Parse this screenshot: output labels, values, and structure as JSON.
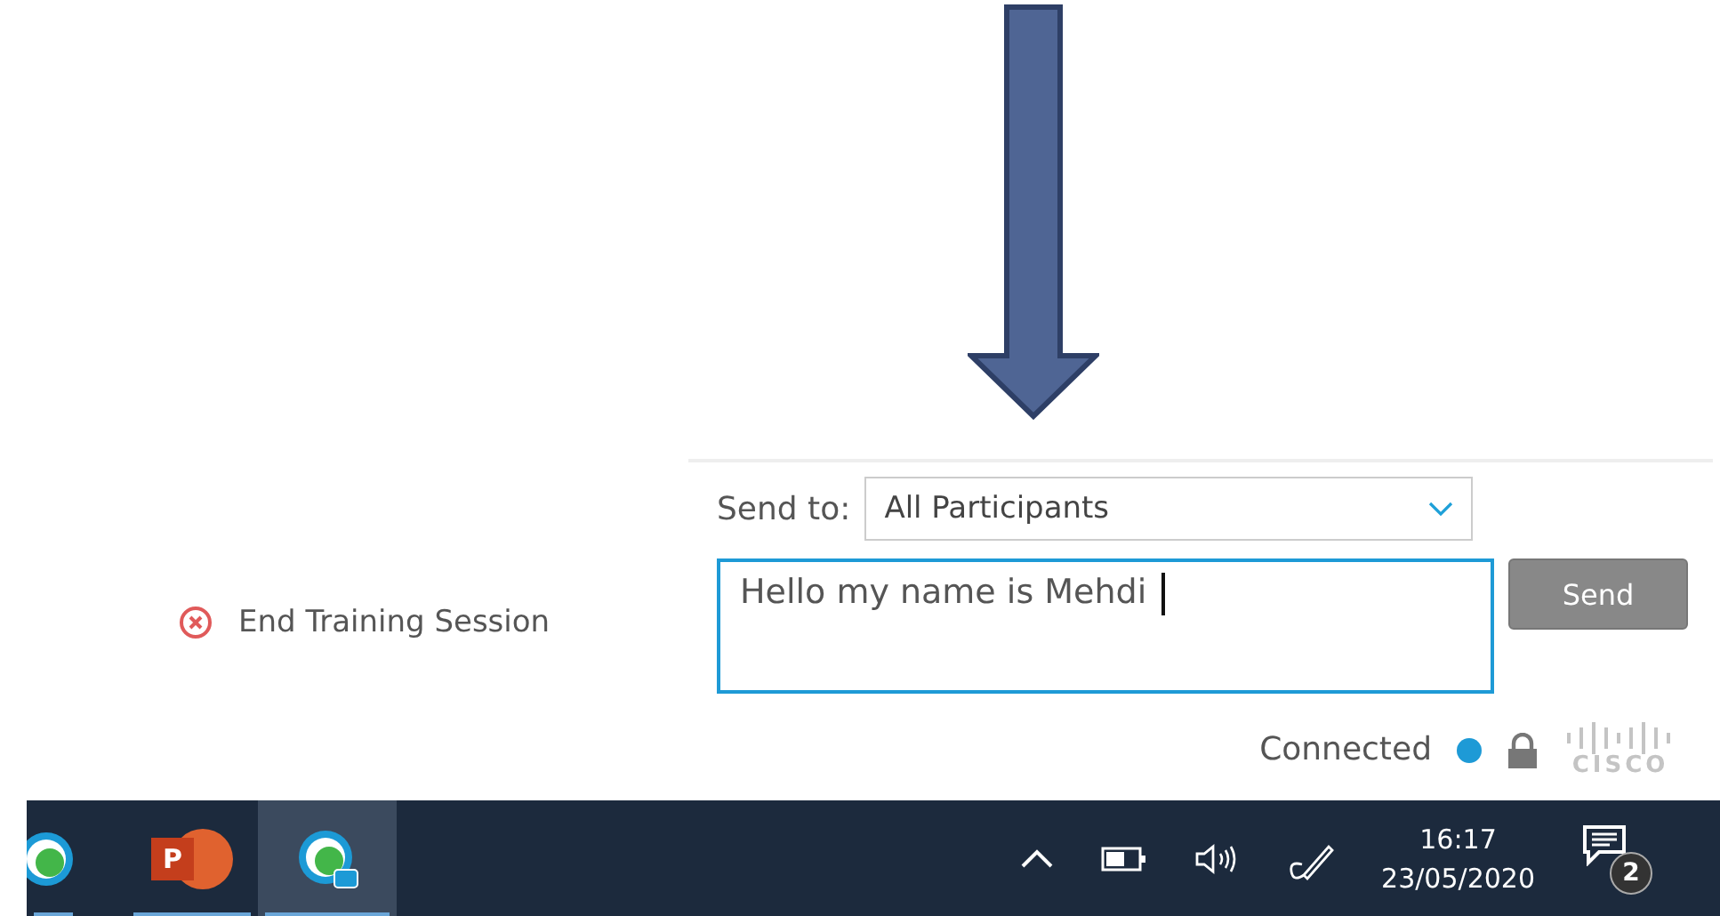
{
  "end_session": {
    "label": "End Training Session"
  },
  "chat": {
    "send_to_label": "Send to:",
    "recipient": "All Participants",
    "message": "Hello my name is Mehdi",
    "send_button": "Send",
    "status": "Connected",
    "connected": true,
    "logo_text": "CISCO"
  },
  "taskbar": {
    "apps": [
      {
        "kind": "webex",
        "selected": false
      },
      {
        "kind": "powerpoint",
        "selected": false,
        "letter": "P"
      },
      {
        "kind": "webex-chat",
        "selected": true
      }
    ],
    "time": "16:17",
    "date": "23/05/2020",
    "notification_count": "2"
  }
}
